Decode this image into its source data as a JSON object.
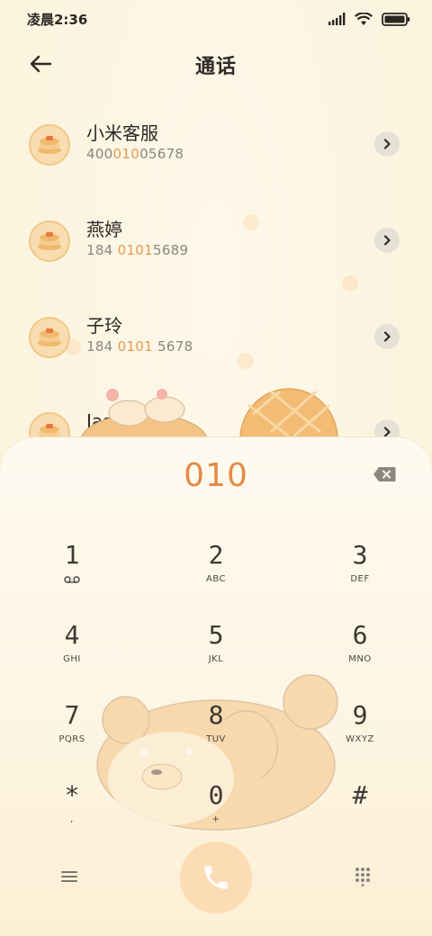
{
  "status_bar": {
    "time": "凌晨2:36",
    "icons": [
      "signal-icon",
      "wifi-icon",
      "battery-icon"
    ]
  },
  "header": {
    "title": "通话",
    "back_icon": "arrow-left-icon"
  },
  "contacts": [
    {
      "name": "小米客服",
      "number_parts": [
        "400",
        "010",
        "05678"
      ]
    },
    {
      "name": "燕婷",
      "number_parts": [
        "184 ",
        "0101",
        "5689"
      ]
    },
    {
      "name": "子玲",
      "number_parts": [
        "184 ",
        "0101",
        " 5678"
      ]
    },
    {
      "name": "Jason",
      "number_parts": [
        "",
        "",
        ""
      ]
    }
  ],
  "dialer": {
    "input": "010",
    "delete_icon": "backspace-icon",
    "keys": [
      {
        "digit": "1",
        "letters": ""
      },
      {
        "digit": "2",
        "letters": "ABC"
      },
      {
        "digit": "3",
        "letters": "DEF"
      },
      {
        "digit": "4",
        "letters": "GHI"
      },
      {
        "digit": "5",
        "letters": "JKL"
      },
      {
        "digit": "6",
        "letters": "MNO"
      },
      {
        "digit": "7",
        "letters": "PQRS"
      },
      {
        "digit": "8",
        "letters": "TUV"
      },
      {
        "digit": "9",
        "letters": "WXYZ"
      },
      {
        "digit": "*",
        "letters": ","
      },
      {
        "digit": "0",
        "letters": "+"
      },
      {
        "digit": "#",
        "letters": ""
      }
    ]
  },
  "bottom_bar": {
    "menu_icon": "menu-icon",
    "call_icon": "phone-icon",
    "keypad_icon": "dialpad-grid-icon"
  },
  "colors": {
    "accent": "#e48a45",
    "background": "#fdf7e6",
    "call_button": "#fbdcb4"
  }
}
